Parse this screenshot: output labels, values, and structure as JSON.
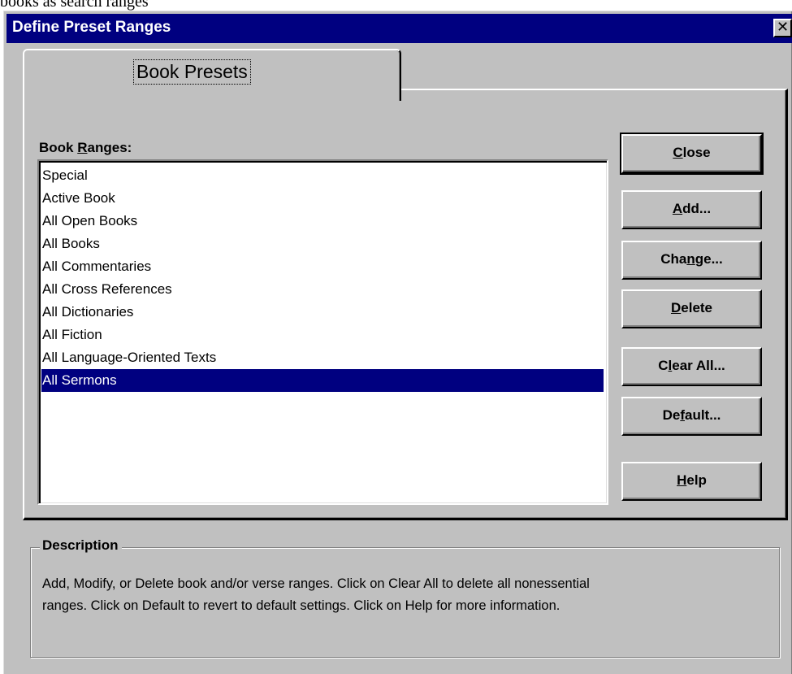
{
  "caption_fragment": "books as search ranges",
  "window": {
    "title": "Define Preset Ranges",
    "close_glyph": "✕"
  },
  "tab": {
    "label": "Book Presets"
  },
  "list": {
    "label_pre": "Book ",
    "label_key": "R",
    "label_post": "anges:",
    "items": [
      "Special",
      "Active Book",
      "All Open Books",
      "All Books",
      "All Commentaries",
      "All Cross References",
      "All Dictionaries",
      "All Fiction",
      "All Language-Oriented Texts",
      "All Sermons"
    ],
    "selected": "All Sermons"
  },
  "buttons": {
    "close": {
      "pre": "",
      "key": "C",
      "post": "lose"
    },
    "add": {
      "pre": "",
      "key": "A",
      "post": "dd..."
    },
    "change": {
      "pre": "Cha",
      "key": "n",
      "post": "ge..."
    },
    "delete": {
      "pre": "",
      "key": "D",
      "post": "elete"
    },
    "clear_all": {
      "pre": "C",
      "key": "l",
      "post": "ear All..."
    },
    "default": {
      "pre": "De",
      "key": "f",
      "post": "ault..."
    },
    "help": {
      "pre": "",
      "key": "H",
      "post": "elp"
    }
  },
  "description": {
    "title": "Description",
    "line1": "Add, Modify, or Delete book and/or verse ranges. Click on Clear All to delete all nonessential",
    "line2": "ranges. Click on Default to revert to default settings. Click on Help for more information."
  },
  "colors": {
    "face": "#c0c0c0",
    "titlebar": "#000080",
    "selection": "#000080"
  }
}
